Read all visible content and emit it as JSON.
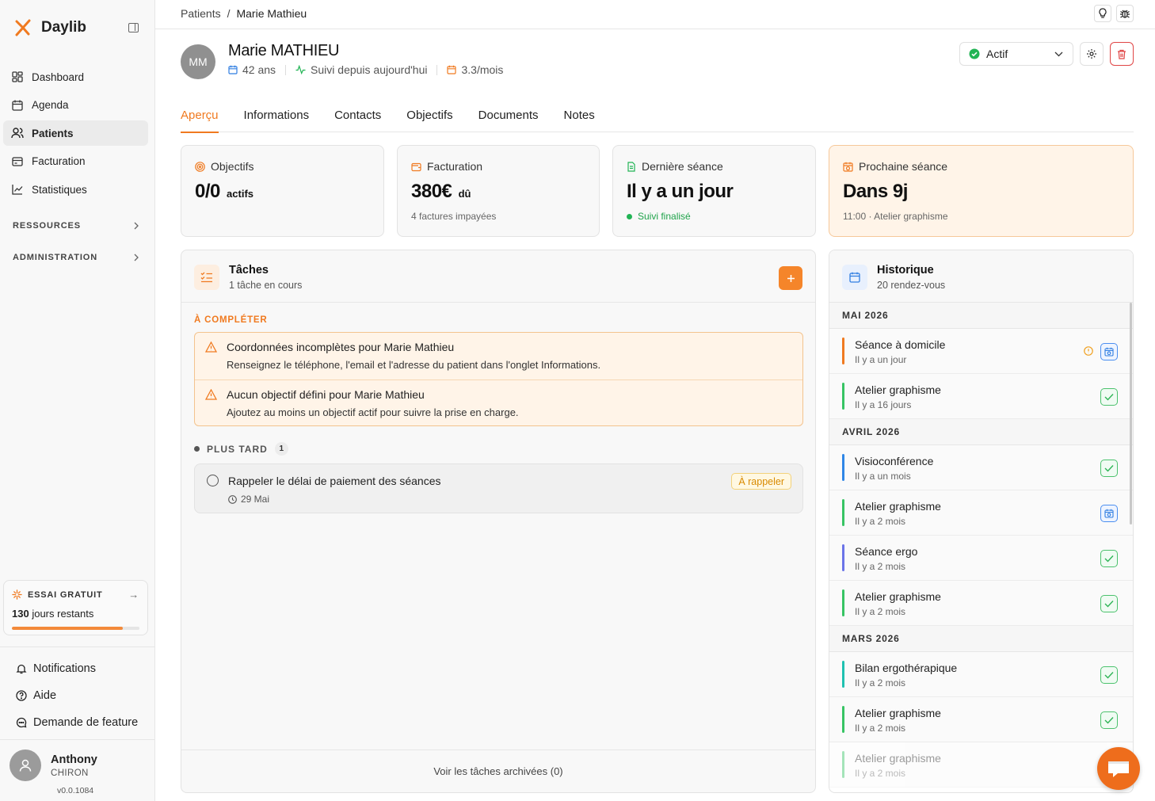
{
  "app": {
    "name": "Daylib",
    "accent": "#f07a20"
  },
  "sidebar": {
    "nav": [
      {
        "label": "Dashboard",
        "icon": "dashboard-icon"
      },
      {
        "label": "Agenda",
        "icon": "calendar-icon"
      },
      {
        "label": "Patients",
        "icon": "users-icon",
        "active": true
      },
      {
        "label": "Facturation",
        "icon": "billing-icon"
      },
      {
        "label": "Statistiques",
        "icon": "chart-icon"
      }
    ],
    "sections": [
      {
        "label": "RESSOURCES"
      },
      {
        "label": "ADMINISTRATION"
      }
    ],
    "trial": {
      "title": "ESSAI GRATUIT",
      "days": "130",
      "days_suffix": "jours restants",
      "progress": 0.87
    },
    "footer_links": [
      {
        "label": "Notifications",
        "icon": "bell-icon"
      },
      {
        "label": "Aide",
        "icon": "help-icon"
      },
      {
        "label": "Demande de feature",
        "icon": "chat-bubble-icon"
      }
    ],
    "user": {
      "first": "Anthony",
      "last": "CHIRON"
    },
    "version": "v0.0.1084"
  },
  "breadcrumb": {
    "parent": "Patients",
    "sep": "/",
    "current": "Marie Mathieu"
  },
  "patient": {
    "initials": "MM",
    "name": "Marie MATHIEU",
    "age": "42 ans",
    "since": "Suivi depuis aujourd'hui",
    "freq": "3.3/mois",
    "status": "Actif"
  },
  "tabs": [
    "Aperçu",
    "Informations",
    "Contacts",
    "Objectifs",
    "Documents",
    "Notes"
  ],
  "cards": {
    "objectifs": {
      "label": "Objectifs",
      "value": "0/0",
      "unit": "actifs"
    },
    "facturation": {
      "label": "Facturation",
      "value": "380€",
      "unit": "dû",
      "sub": "4 factures impayées"
    },
    "derniere": {
      "label": "Dernière séance",
      "value": "Il y a un jour",
      "sub": "Suivi finalisé"
    },
    "prochaine": {
      "label": "Prochaine séance",
      "value": "Dans 9j",
      "sub": "11:00 · Atelier graphisme"
    }
  },
  "tasks": {
    "title": "Tâches",
    "subtitle": "1 tâche en cours",
    "todo_label": "À COMPLÉTER",
    "alerts": [
      {
        "title": "Coordonnées incomplètes pour Marie Mathieu",
        "desc": "Renseignez le téléphone, l'email et l'adresse du patient dans l'onglet Informations."
      },
      {
        "title": "Aucun objectif défini pour Marie Mathieu",
        "desc": "Ajoutez au moins un objectif actif pour suivre la prise en charge."
      }
    ],
    "later_label": "PLUS TARD",
    "later_count": "1",
    "later_item": {
      "title": "Rappeler le délai de paiement des séances",
      "date": "29 Mai",
      "badge": "À rappeler"
    },
    "archived": "Voir les tâches archivées (0)"
  },
  "history": {
    "title": "Historique",
    "subtitle": "20 rendez-vous",
    "groups": [
      {
        "month": "MAI 2026",
        "items": [
          {
            "title": "Séance à domicile",
            "when": "Il y a un jour",
            "color": "#f07a20",
            "status": "calendar",
            "warn": true
          },
          {
            "title": "Atelier graphisme",
            "when": "Il y a 16 jours",
            "color": "#37c464",
            "status": "done"
          }
        ]
      },
      {
        "month": "AVRIL 2026",
        "items": [
          {
            "title": "Visioconférence",
            "when": "Il y a un mois",
            "color": "#2f86e6",
            "status": "done"
          },
          {
            "title": "Atelier graphisme",
            "when": "Il y a 2 mois",
            "color": "#37c464",
            "status": "calendar"
          },
          {
            "title": "Séance ergo",
            "when": "Il y a 2 mois",
            "color": "#6b74e8",
            "status": "done"
          },
          {
            "title": "Atelier graphisme",
            "when": "Il y a 2 mois",
            "color": "#37c464",
            "status": "done"
          }
        ]
      },
      {
        "month": "MARS 2026",
        "items": [
          {
            "title": "Bilan ergothérapique",
            "when": "Il y a 2 mois",
            "color": "#1fc1b1",
            "status": "done"
          },
          {
            "title": "Atelier graphisme",
            "when": "Il y a 2 mois",
            "color": "#37c464",
            "status": "done"
          },
          {
            "title": "Atelier graphisme",
            "when": "Il y a 2 mois",
            "color": "#37c464",
            "status": "done",
            "fade": true
          }
        ]
      }
    ]
  }
}
